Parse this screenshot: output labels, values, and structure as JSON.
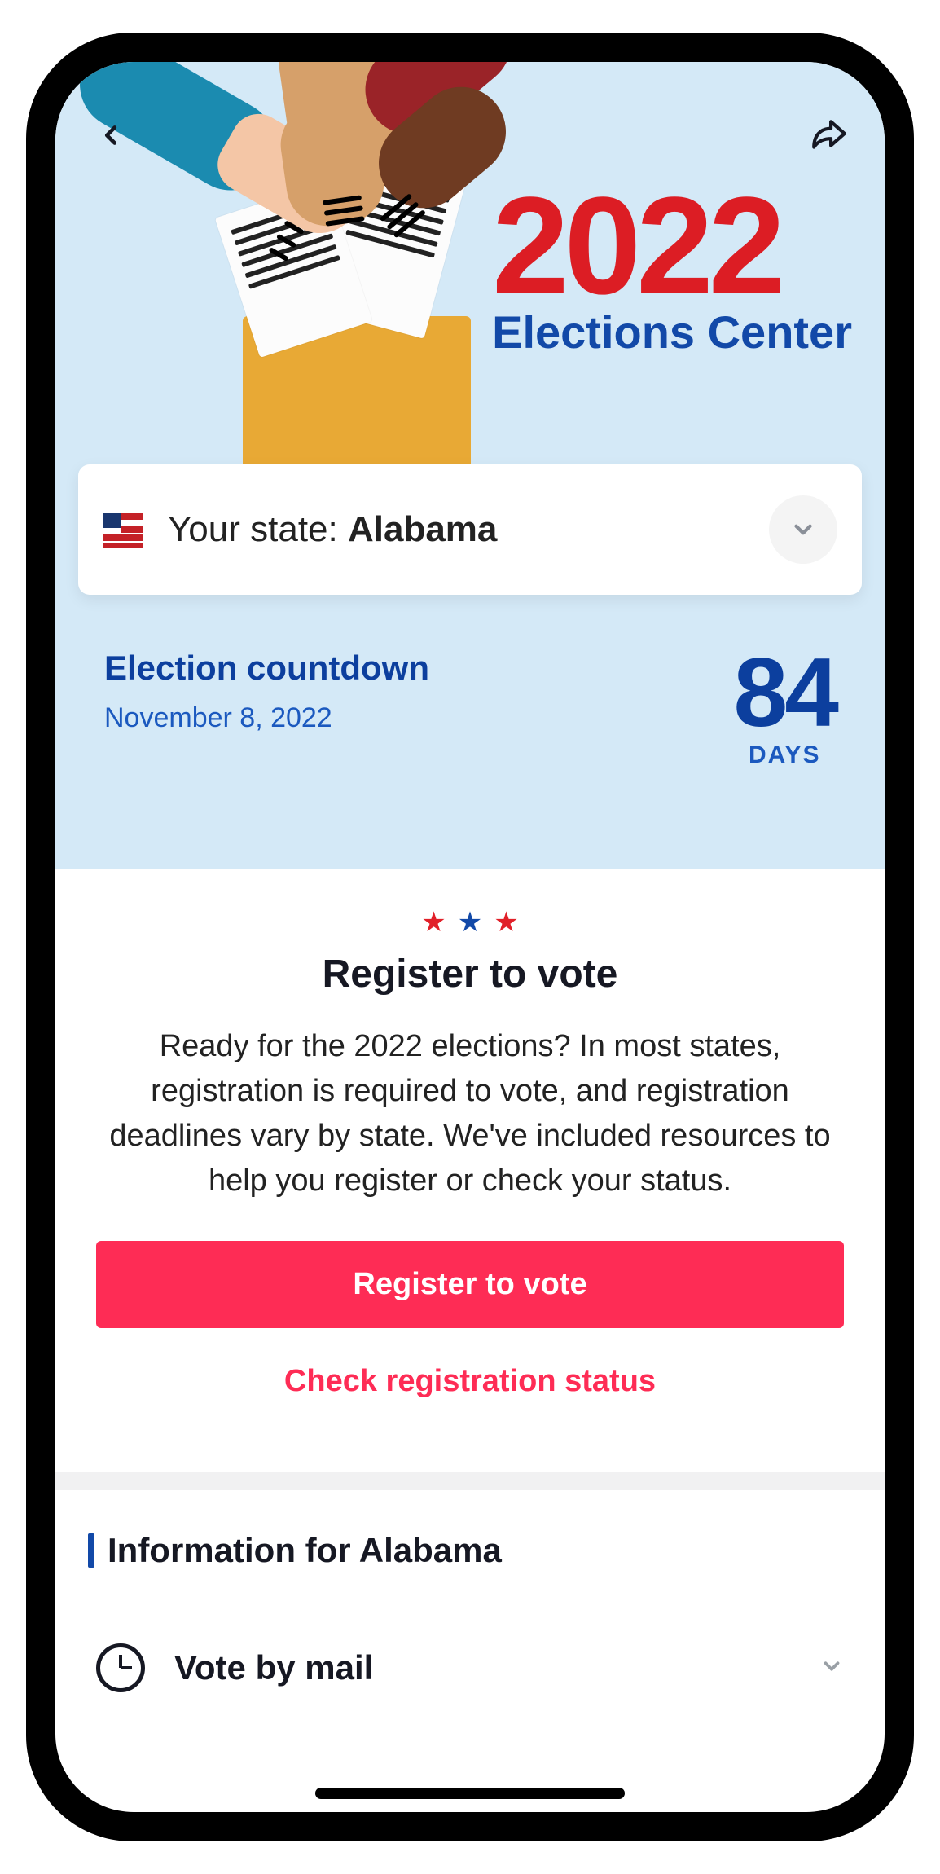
{
  "header": {
    "year": "2022",
    "subtitle": "Elections Center"
  },
  "state_selector": {
    "label_prefix": "Your state: ",
    "state": "Alabama"
  },
  "countdown": {
    "title": "Election countdown",
    "date": "November 8, 2022",
    "days_number": "84",
    "days_label": "DAYS"
  },
  "register": {
    "title": "Register to vote",
    "body": "Ready for the 2022 elections? In most states, registration is required to vote, and registration deadlines vary by state. We've included resources to help you register or check your status.",
    "primary_cta": "Register to vote",
    "secondary_cta": "Check registration status"
  },
  "info": {
    "heading": "Information for Alabama",
    "items": [
      {
        "label": "Vote by mail"
      }
    ]
  },
  "colors": {
    "red": "#dc1d24",
    "blue": "#1249a8",
    "pink": "#fe2c55",
    "hero_bg": "#d4e9f7"
  }
}
